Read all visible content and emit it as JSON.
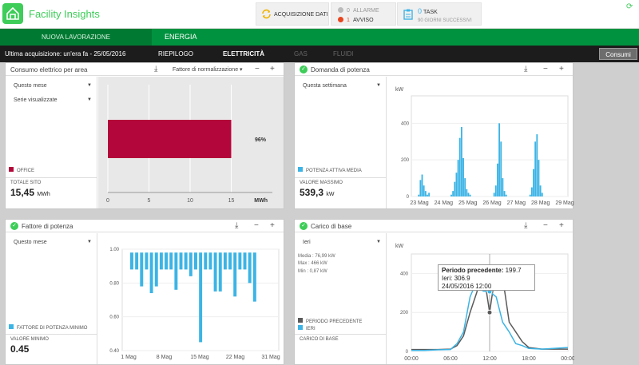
{
  "app": {
    "title": "Facility Insights"
  },
  "header": {
    "acquisition_label": "ACQUISIZIONE DATI",
    "alarms": {
      "count": "0",
      "label": "ALLARME"
    },
    "warnings": {
      "count": "1",
      "label": "AVVISO"
    },
    "tasks": {
      "count": "0",
      "label": "TASK",
      "sublabel": "90 GIORNI SUCCESSIVI"
    }
  },
  "nav": {
    "tab1": "NUOVA LAVORAZIONE",
    "tab2": "ENERGIA"
  },
  "subnav": {
    "last_acquisition": "Ultima acquisizione: un'era fa - 25/05/2016",
    "tabs": [
      "RIEPILOGO",
      "ELETTRICITÀ",
      "GAS",
      "FLUIDI"
    ],
    "consumi_button": "Consumi"
  },
  "panel1": {
    "title": "Consumo elettrico per area",
    "normalization": "Fattore di normalizzazione",
    "period": "Questo mese",
    "series_select": "Serie visualizzate",
    "legend": "OFFICE",
    "total_label": "TOTALE SITO",
    "total_value": "15,45",
    "total_unit": "MWh",
    "percent_label": "96%"
  },
  "panel2": {
    "title": "Domanda di potenza",
    "period": "Questa settimana",
    "legend": "POTENZA ATTIVA MEDIA",
    "max_label": "VALORE MASSIMO",
    "max_value": "539,3",
    "max_unit": "kW"
  },
  "panel3": {
    "title": "Fattore di potenza",
    "period": "Questo mese",
    "legend": "FATTORE DI POTENZA MINIMO",
    "min_label": "VALORE MINIMO",
    "min_value": "0.45"
  },
  "panel4": {
    "title": "Carico di base",
    "period": "Ieri",
    "stats": [
      "Media : 76,99 kW",
      "Max : 466 kW",
      "Min : 0,87 kW"
    ],
    "legend_prev": "PERIODO PRECEDENTE",
    "legend_ieri": "IERI",
    "base_label": "CARICO DI BASE",
    "tooltip": {
      "prev_label": "Periodo precedente:",
      "prev_value": "199.7",
      "ieri_label": "Ieri:",
      "ieri_value": "306.9",
      "datetime": "24/05/2016 12:00"
    }
  },
  "colors": {
    "brand_green": "#3dcd58",
    "dark_green": "#00923f",
    "office": "#b3063a",
    "blue": "#3cb4e5",
    "gray_series": "#5a5a5a"
  },
  "chart_data": [
    {
      "type": "bar",
      "orientation": "horizontal",
      "categories": [
        "OFFICE"
      ],
      "values": [
        15
      ],
      "data_labels": [
        "96%"
      ],
      "xlim": [
        0,
        20
      ],
      "xticks": [
        "0",
        "5",
        "10",
        "15"
      ],
      "xlabel": "MWh"
    },
    {
      "type": "bar",
      "ylabel": "kW",
      "ylim": [
        0,
        550
      ],
      "yticks": [
        "0",
        "200",
        "400"
      ],
      "x": [
        "23 Mag",
        "24 Mag",
        "25 Mag",
        "26 Mag",
        "27 Mag",
        "28 Mag",
        "29 Mag"
      ],
      "series": [
        {
          "name": "POTENZA ATTIVA MEDIA",
          "values": [
            0,
            0,
            10,
            90,
            120,
            60,
            30,
            10,
            20,
            0,
            0,
            0,
            0,
            0,
            0,
            0,
            0,
            0,
            0,
            0,
            0,
            10,
            30,
            80,
            130,
            200,
            320,
            380,
            210,
            100,
            40,
            20,
            10,
            0,
            0,
            0,
            0,
            0,
            0,
            0,
            0,
            0,
            0,
            0,
            0,
            0,
            20,
            60,
            180,
            400,
            300,
            100,
            30,
            10,
            0,
            0,
            0,
            0,
            0,
            0,
            0,
            0,
            0,
            0,
            0,
            0,
            0,
            10,
            50,
            150,
            300,
            340,
            200,
            60,
            20,
            0,
            0,
            0,
            0,
            0,
            0,
            0
          ]
        }
      ]
    },
    {
      "type": "bar",
      "ylim": [
        0.4,
        1.0
      ],
      "yticks": [
        "0.40",
        "0.60",
        "0.80",
        "1.00"
      ],
      "x": [
        "1 Mag",
        "8 Mag",
        "15 Mag",
        "22 Mag",
        "31 Mag"
      ],
      "series": [
        {
          "name": "FATTORE DI POTENZA MINIMO",
          "values": [
            0.88,
            0.88,
            0.78,
            0.88,
            0.74,
            0.78,
            0.88,
            0.88,
            0.88,
            0.76,
            0.88,
            0.88,
            0.84,
            0.88,
            0.45,
            0.88,
            0.88,
            0.75,
            0.75,
            0.88,
            0.88,
            0.72,
            0.88,
            0.88,
            0.8,
            0.69
          ]
        }
      ]
    },
    {
      "type": "line",
      "ylabel": "kW",
      "ylim": [
        0,
        500
      ],
      "yticks": [
        "0",
        "200",
        "400"
      ],
      "x": [
        "00:00",
        "06:00",
        "12:00",
        "18:00",
        "00:00"
      ],
      "series": [
        {
          "name": "PERIODO PRECEDENTE",
          "points": [
            [
              0,
              10
            ],
            [
              2,
              10
            ],
            [
              4,
              10
            ],
            [
              6,
              12
            ],
            [
              7,
              30
            ],
            [
              8,
              80
            ],
            [
              9,
              200
            ],
            [
              10,
              300
            ],
            [
              11,
              420
            ],
            [
              12,
              200
            ],
            [
              13,
              430
            ],
            [
              14,
              380
            ],
            [
              15,
              150
            ],
            [
              16,
              100
            ],
            [
              17,
              50
            ],
            [
              18,
              20
            ],
            [
              20,
              12
            ],
            [
              24,
              12
            ]
          ]
        },
        {
          "name": "IERI",
          "points": [
            [
              0,
              5
            ],
            [
              2,
              5
            ],
            [
              4,
              8
            ],
            [
              6,
              10
            ],
            [
              7,
              40
            ],
            [
              8,
              100
            ],
            [
              9,
              280
            ],
            [
              10,
              360
            ],
            [
              11,
              310
            ],
            [
              12,
              307
            ],
            [
              13,
              280
            ],
            [
              14,
              150
            ],
            [
              15,
              100
            ],
            [
              16,
              40
            ],
            [
              17,
              30
            ],
            [
              18,
              15
            ],
            [
              20,
              12
            ],
            [
              24,
              20
            ]
          ]
        }
      ]
    }
  ]
}
